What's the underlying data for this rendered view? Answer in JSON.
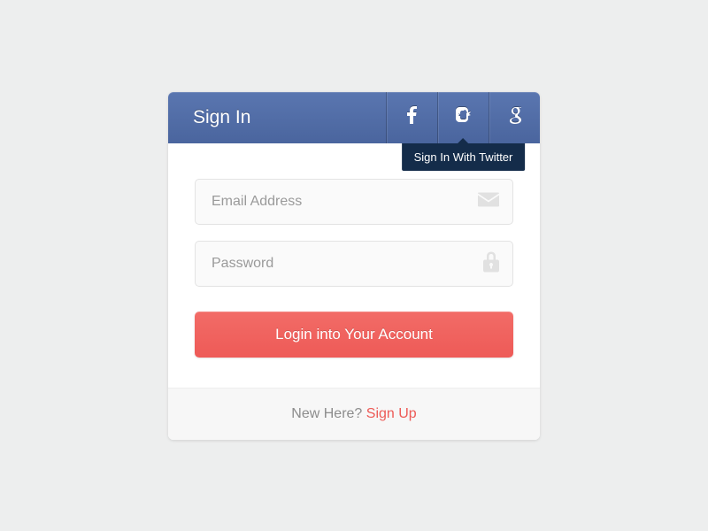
{
  "header": {
    "title": "Sign In",
    "social": {
      "facebook": "facebook",
      "twitter": "twitter",
      "google": "google"
    },
    "tooltip": "Sign In With Twitter"
  },
  "form": {
    "email_placeholder": "Email Address",
    "email_value": "",
    "password_placeholder": "Password",
    "password_value": "",
    "login_button": "Login into Your Account"
  },
  "footer": {
    "prompt": "New Here? ",
    "signup": "Sign Up"
  },
  "colors": {
    "header_bg": "#4f6aa3",
    "accent": "#ee5a57",
    "page_bg": "#edeeee"
  }
}
